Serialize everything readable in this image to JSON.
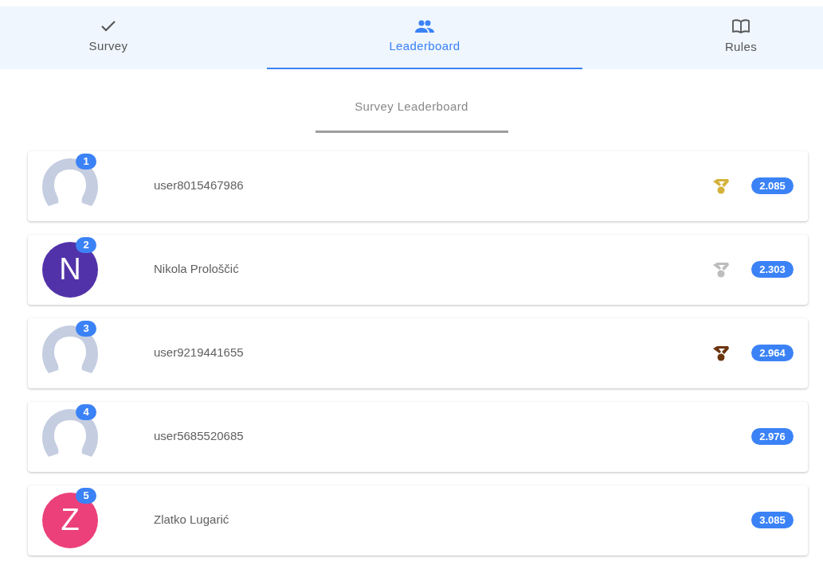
{
  "tabs": [
    {
      "label": "Survey",
      "selected": false
    },
    {
      "label": "Leaderboard",
      "selected": true
    },
    {
      "label": "Rules",
      "selected": false
    }
  ],
  "heading": "Survey Leaderboard",
  "entries": [
    {
      "rank": "1",
      "name": "user8015467986",
      "avatar": {
        "kind": "silhouette"
      },
      "color": "#d4b23a",
      "score": "2.085"
    },
    {
      "rank": "2",
      "name": "Nikola Prološčić",
      "avatar": {
        "kind": "letter",
        "letter": "N",
        "color": "#5232a8"
      },
      "color": "#bdbdbd",
      "score": "2.303"
    },
    {
      "rank": "3",
      "name": "user9219441655",
      "avatar": {
        "kind": "silhouette"
      },
      "color": "#6b3510",
      "score": "2.964"
    },
    {
      "rank": "4",
      "name": "user5685520685",
      "avatar": {
        "kind": "silhouette"
      },
      "score": "2.976"
    },
    {
      "rank": "5",
      "name": "Zlatko Lugarić",
      "avatar": {
        "kind": "letter",
        "letter": "Z",
        "color": "#ec407a"
      },
      "score": "3.085"
    }
  ]
}
